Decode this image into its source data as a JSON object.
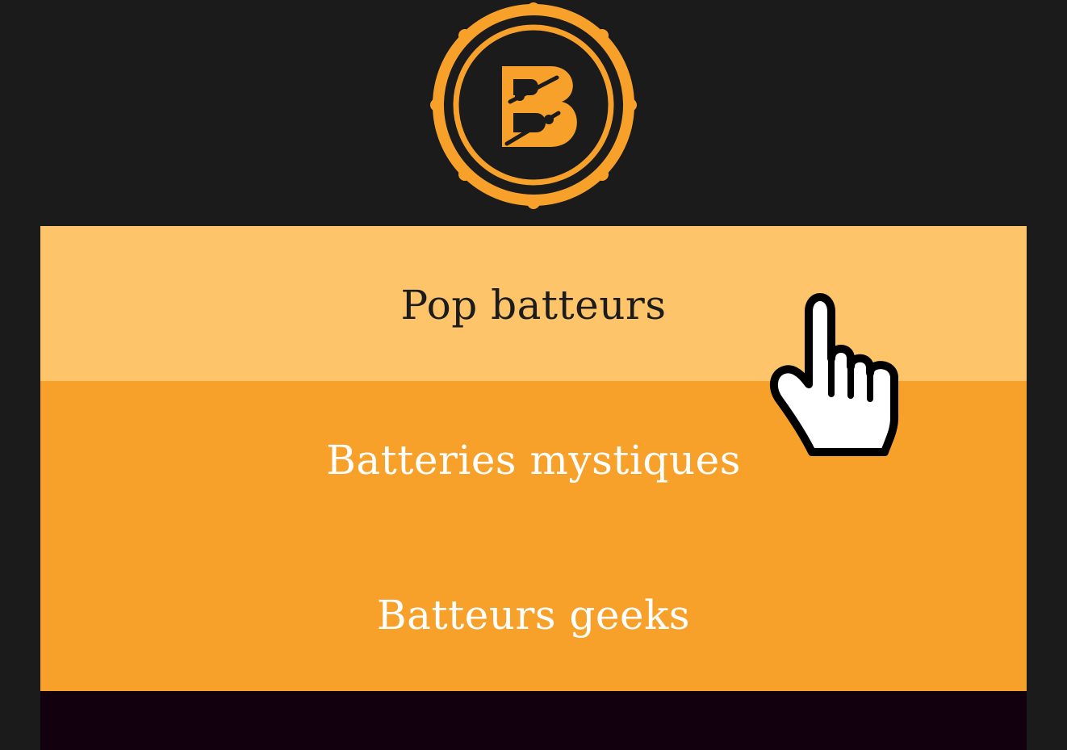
{
  "brand": {
    "logo_icon": "drum-b-logo-icon",
    "logo_letter": "B",
    "accent_color": "#f7a12b",
    "highlight_color": "#fdc469",
    "background_color": "#1b1b1b"
  },
  "menu": {
    "items": [
      {
        "label": "Pop batteurs",
        "state": "hover"
      },
      {
        "label": "Batteries mystiques",
        "state": "default"
      },
      {
        "label": "Batteurs geeks",
        "state": "default"
      }
    ]
  },
  "cursor": {
    "icon": "hand-pointer-icon"
  }
}
